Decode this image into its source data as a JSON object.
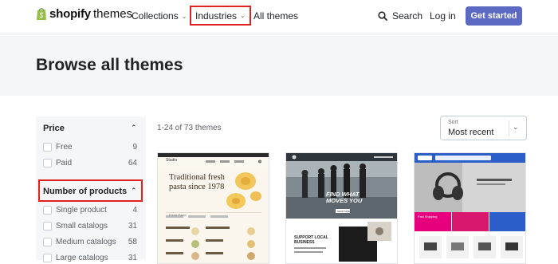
{
  "header": {
    "logo_word": "shopify",
    "logo_sub": "themes",
    "nav": {
      "collections": "Collections",
      "industries": "Industries",
      "all_themes": "All themes",
      "search": "Search",
      "login": "Log in",
      "get_started": "Get started"
    }
  },
  "hero": {
    "title": "Browse all themes"
  },
  "sidebar": {
    "price": {
      "title": "Price",
      "items": [
        {
          "label": "Free",
          "count": "9"
        },
        {
          "label": "Paid",
          "count": "64"
        }
      ]
    },
    "products": {
      "title": "Number of products",
      "items": [
        {
          "label": "Single product",
          "count": "4"
        },
        {
          "label": "Small catalogs",
          "count": "31"
        },
        {
          "label": "Medium catalogs",
          "count": "58"
        },
        {
          "label": "Large catalogs",
          "count": "31"
        }
      ]
    }
  },
  "results": {
    "count_text": "1-24 of 73 themes"
  },
  "sort": {
    "label": "Sort",
    "value": "Most recent"
  },
  "cards": [
    {
      "brand": "Studio",
      "headline": "Traditional fresh pasta since 1978",
      "menu_title": "Fresh Pasta"
    },
    {
      "headline": "FIND WHAT MOVES YOU",
      "button": "SHOP NOW",
      "subhead": "SUPPORT LOCAL BUSINESS"
    },
    {
      "banner": "Fast Shipping"
    }
  ],
  "colors": {
    "accent": "#5c6ac4",
    "highlight": "#e0211f",
    "hero_bg": "#f4f6f8"
  }
}
